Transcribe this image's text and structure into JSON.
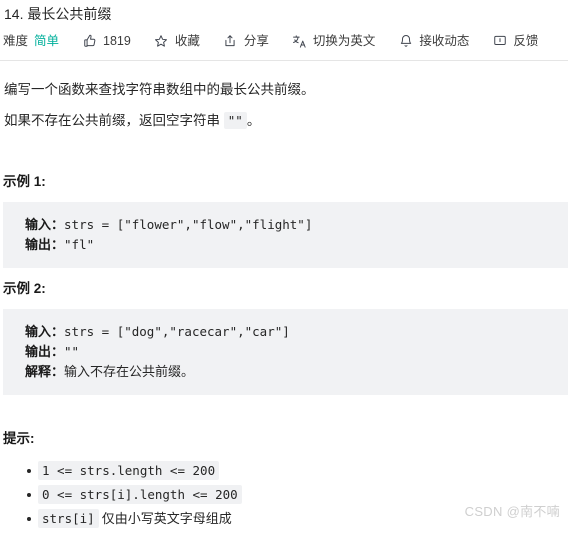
{
  "problem": {
    "title": "14. 最长公共前缀",
    "meta": {
      "difficulty_label": "难度",
      "difficulty_value": "简单",
      "difficulty_color": "#00af9b",
      "items": [
        {
          "icon": "thumbs-up-icon",
          "label": "1819"
        },
        {
          "icon": "star-icon",
          "label": "收藏"
        },
        {
          "icon": "share-icon",
          "label": "分享"
        },
        {
          "icon": "translate-icon",
          "label": "切换为英文"
        },
        {
          "icon": "bell-icon",
          "label": "接收动态"
        },
        {
          "icon": "feedback-icon",
          "label": "反馈"
        }
      ]
    },
    "description": {
      "line1": "编写一个函数来查找字符串数组中的最长公共前缀。",
      "line2_prefix": "如果不存在公共前缀，返回空字符串 ",
      "line2_code": "\"\"",
      "line2_suffix": "。"
    },
    "examples": [
      {
        "heading": "示例 1:",
        "input_key": "输入：",
        "input_value": "strs = [\"flower\",\"flow\",\"flight\"]",
        "output_key": "输出：",
        "output_value": "\"fl\""
      },
      {
        "heading": "示例 2:",
        "input_key": "输入：",
        "input_value": "strs = [\"dog\",\"racecar\",\"car\"]",
        "output_key": "输出：",
        "output_value": "\"\"",
        "explain_key": "解释：",
        "explain_value": "输入不存在公共前缀。"
      }
    ],
    "hints": {
      "heading": "提示:",
      "items": [
        {
          "code": "1 <= strs.length <= 200",
          "text": ""
        },
        {
          "code": "0 <= strs[i].length <= 200",
          "text": ""
        },
        {
          "code": "strs[i]",
          "text": "仅由小写英文字母组成"
        }
      ]
    }
  },
  "watermark": "CSDN @南不喃"
}
